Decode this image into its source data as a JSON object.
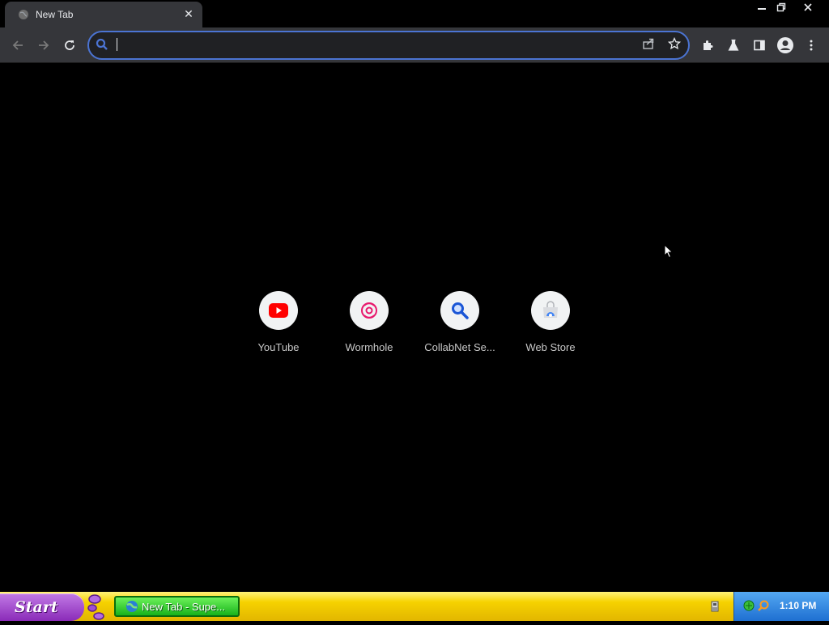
{
  "tab": {
    "title": "New Tab",
    "close_glyph": "✕"
  },
  "omnibox": {
    "value": "",
    "placeholder": ""
  },
  "shortcuts": [
    {
      "label": "YouTube",
      "icon": "youtube-icon"
    },
    {
      "label": "Wormhole",
      "icon": "wormhole-icon"
    },
    {
      "label": "CollabNet Se...",
      "icon": "search-icon"
    },
    {
      "label": "Web Store",
      "icon": "web-store-icon"
    }
  ],
  "taskbar": {
    "start_label": "Start",
    "task_label": "New Tab - Supe...",
    "clock": "1:10 PM"
  },
  "colors": {
    "accent": "#4b74d3",
    "youtube_red": "#ff0000",
    "wormhole_pink": "#e8186d",
    "search_blue": "#1a56d6",
    "taskbar_yellow": "#f6d200",
    "start_purple": "#8a2bb8",
    "tray_blue": "#1e6fd1"
  }
}
